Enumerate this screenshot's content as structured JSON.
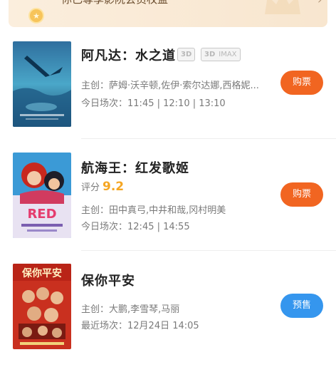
{
  "member_banner": {
    "text": "你已尊享影院会员权益",
    "arrow": "›"
  },
  "movies": [
    {
      "title": "阿凡达：水之道",
      "tags": [
        "3D",
        "3D",
        "IMAX"
      ],
      "cast_label": "主创：",
      "cast": "萨姆·沃辛顿,佐伊·索尔达娜,西格妮...",
      "schedule_label": "今日场次：",
      "schedule": "11:45 | 12:10 | 13:10",
      "button": "购票",
      "button_color": "#f16521"
    },
    {
      "title": "航海王：红发歌姬",
      "score_label": "评分",
      "score": "9.2",
      "cast_label": "主创：",
      "cast": "田中真弓,中井和哉,冈村明美",
      "schedule_label": "今日场次：",
      "schedule": "12:45 | 14:55",
      "button": "购票",
      "button_color": "#f16521"
    },
    {
      "title": "保你平安",
      "cast_label": "主创：",
      "cast": "大鹏,李雪琴,马丽",
      "schedule_label": "最近场次：",
      "schedule": "12月24日 14:05",
      "button": "预售",
      "button_color": "#3596ee"
    }
  ]
}
